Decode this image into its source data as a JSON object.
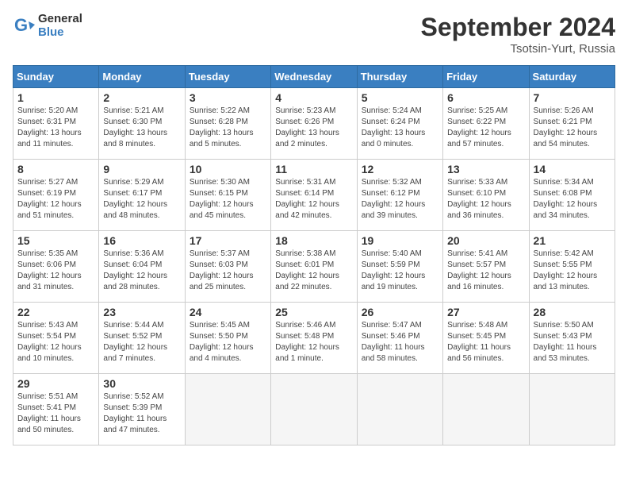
{
  "header": {
    "logo_line1": "General",
    "logo_line2": "Blue",
    "month": "September 2024",
    "location": "Tsotsin-Yurt, Russia"
  },
  "days_of_week": [
    "Sunday",
    "Monday",
    "Tuesday",
    "Wednesday",
    "Thursday",
    "Friday",
    "Saturday"
  ],
  "weeks": [
    [
      {
        "day": "1",
        "info": "Sunrise: 5:20 AM\nSunset: 6:31 PM\nDaylight: 13 hours and 11 minutes."
      },
      {
        "day": "2",
        "info": "Sunrise: 5:21 AM\nSunset: 6:30 PM\nDaylight: 13 hours and 8 minutes."
      },
      {
        "day": "3",
        "info": "Sunrise: 5:22 AM\nSunset: 6:28 PM\nDaylight: 13 hours and 5 minutes."
      },
      {
        "day": "4",
        "info": "Sunrise: 5:23 AM\nSunset: 6:26 PM\nDaylight: 13 hours and 2 minutes."
      },
      {
        "day": "5",
        "info": "Sunrise: 5:24 AM\nSunset: 6:24 PM\nDaylight: 13 hours and 0 minutes."
      },
      {
        "day": "6",
        "info": "Sunrise: 5:25 AM\nSunset: 6:22 PM\nDaylight: 12 hours and 57 minutes."
      },
      {
        "day": "7",
        "info": "Sunrise: 5:26 AM\nSunset: 6:21 PM\nDaylight: 12 hours and 54 minutes."
      }
    ],
    [
      {
        "day": "8",
        "info": "Sunrise: 5:27 AM\nSunset: 6:19 PM\nDaylight: 12 hours and 51 minutes."
      },
      {
        "day": "9",
        "info": "Sunrise: 5:29 AM\nSunset: 6:17 PM\nDaylight: 12 hours and 48 minutes."
      },
      {
        "day": "10",
        "info": "Sunrise: 5:30 AM\nSunset: 6:15 PM\nDaylight: 12 hours and 45 minutes."
      },
      {
        "day": "11",
        "info": "Sunrise: 5:31 AM\nSunset: 6:14 PM\nDaylight: 12 hours and 42 minutes."
      },
      {
        "day": "12",
        "info": "Sunrise: 5:32 AM\nSunset: 6:12 PM\nDaylight: 12 hours and 39 minutes."
      },
      {
        "day": "13",
        "info": "Sunrise: 5:33 AM\nSunset: 6:10 PM\nDaylight: 12 hours and 36 minutes."
      },
      {
        "day": "14",
        "info": "Sunrise: 5:34 AM\nSunset: 6:08 PM\nDaylight: 12 hours and 34 minutes."
      }
    ],
    [
      {
        "day": "15",
        "info": "Sunrise: 5:35 AM\nSunset: 6:06 PM\nDaylight: 12 hours and 31 minutes."
      },
      {
        "day": "16",
        "info": "Sunrise: 5:36 AM\nSunset: 6:04 PM\nDaylight: 12 hours and 28 minutes."
      },
      {
        "day": "17",
        "info": "Sunrise: 5:37 AM\nSunset: 6:03 PM\nDaylight: 12 hours and 25 minutes."
      },
      {
        "day": "18",
        "info": "Sunrise: 5:38 AM\nSunset: 6:01 PM\nDaylight: 12 hours and 22 minutes."
      },
      {
        "day": "19",
        "info": "Sunrise: 5:40 AM\nSunset: 5:59 PM\nDaylight: 12 hours and 19 minutes."
      },
      {
        "day": "20",
        "info": "Sunrise: 5:41 AM\nSunset: 5:57 PM\nDaylight: 12 hours and 16 minutes."
      },
      {
        "day": "21",
        "info": "Sunrise: 5:42 AM\nSunset: 5:55 PM\nDaylight: 12 hours and 13 minutes."
      }
    ],
    [
      {
        "day": "22",
        "info": "Sunrise: 5:43 AM\nSunset: 5:54 PM\nDaylight: 12 hours and 10 minutes."
      },
      {
        "day": "23",
        "info": "Sunrise: 5:44 AM\nSunset: 5:52 PM\nDaylight: 12 hours and 7 minutes."
      },
      {
        "day": "24",
        "info": "Sunrise: 5:45 AM\nSunset: 5:50 PM\nDaylight: 12 hours and 4 minutes."
      },
      {
        "day": "25",
        "info": "Sunrise: 5:46 AM\nSunset: 5:48 PM\nDaylight: 12 hours and 1 minute."
      },
      {
        "day": "26",
        "info": "Sunrise: 5:47 AM\nSunset: 5:46 PM\nDaylight: 11 hours and 58 minutes."
      },
      {
        "day": "27",
        "info": "Sunrise: 5:48 AM\nSunset: 5:45 PM\nDaylight: 11 hours and 56 minutes."
      },
      {
        "day": "28",
        "info": "Sunrise: 5:50 AM\nSunset: 5:43 PM\nDaylight: 11 hours and 53 minutes."
      }
    ],
    [
      {
        "day": "29",
        "info": "Sunrise: 5:51 AM\nSunset: 5:41 PM\nDaylight: 11 hours and 50 minutes."
      },
      {
        "day": "30",
        "info": "Sunrise: 5:52 AM\nSunset: 5:39 PM\nDaylight: 11 hours and 47 minutes."
      },
      {
        "day": "",
        "info": ""
      },
      {
        "day": "",
        "info": ""
      },
      {
        "day": "",
        "info": ""
      },
      {
        "day": "",
        "info": ""
      },
      {
        "day": "",
        "info": ""
      }
    ]
  ]
}
